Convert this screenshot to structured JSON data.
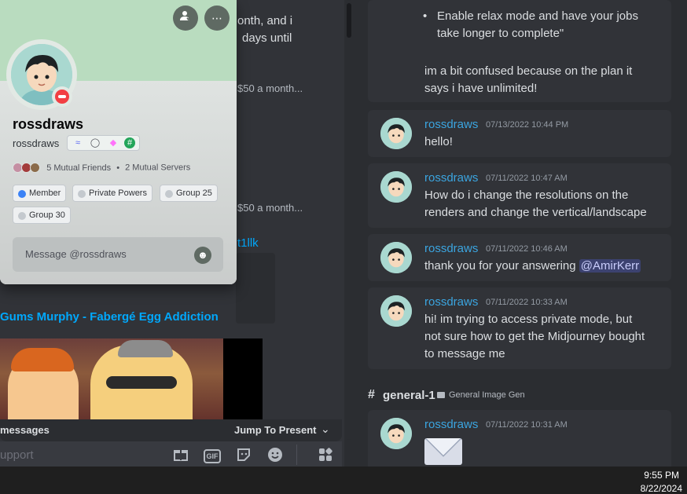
{
  "left_pane": {
    "fragments": [
      {
        "text": "onth, and i"
      },
      {
        "text": "days until"
      },
      {
        "text": "$50 a month..."
      },
      {
        "text": "$50 a month..."
      }
    ],
    "link_tail": "t1llk",
    "video_title": "Gums Murphy - Fabergé Egg Addiction",
    "new_messages_text": "messages",
    "jump_label": "Jump To Present",
    "composer_placeholder": "upport",
    "composer_icons": [
      "gift-icon",
      "gif-icon",
      "sticker-icon",
      "emoji-icon",
      "apps-icon"
    ],
    "gif_label": "GIF"
  },
  "profile": {
    "display_name": "rossdraws",
    "username": "rossdraws",
    "status": "do-not-disturb",
    "mutual_friends": "5 Mutual Friends",
    "mutual_servers": "2 Mutual Servers",
    "roles": [
      {
        "name": "Member",
        "color": "#3b82f6"
      },
      {
        "name": "Private Powers",
        "color": "#c4c9ce"
      },
      {
        "name": "Group 25",
        "color": "#c4c9ce"
      },
      {
        "name": "Group 30",
        "color": "#c4c9ce"
      }
    ],
    "message_placeholder": "Message @rossdraws",
    "badges": [
      "hypesquad-icon",
      "nitro-icon",
      "boost-icon",
      "hashtag-icon"
    ],
    "banner_color": "#b9dcbf"
  },
  "right_pane": {
    "top_card": {
      "bullet_lines": [
        "Enable relax mode and have your jobs",
        "take longer to complete\""
      ],
      "text_lines": [
        "im a bit confused because on the plan it",
        "says i have unlimited!"
      ]
    },
    "messages": [
      {
        "author": "rossdraws",
        "timestamp": "07/13/2022 10:44 PM",
        "lines": [
          "hello!"
        ]
      },
      {
        "author": "rossdraws",
        "timestamp": "07/11/2022 10:47 AM",
        "lines": [
          "How do i change the resolutions on the",
          "renders and change the vertical/landscape"
        ]
      },
      {
        "author": "rossdraws",
        "timestamp": "07/11/2022 10:46 AM",
        "lines": [
          "thank you for your answering "
        ],
        "mention": "@AmirKerr"
      },
      {
        "author": "rossdraws",
        "timestamp": "07/11/2022 10:33 AM",
        "lines": [
          "hi! im trying to access private mode, but",
          "not sure how to get the Midjourney bought",
          "to message me"
        ]
      },
      {
        "author": "rossdraws",
        "timestamp": "07/11/2022 10:31 AM",
        "lines": []
      }
    ],
    "channel": {
      "name": "general-1",
      "category": "General Image Gen"
    }
  },
  "taskbar": {
    "time": "9:55 PM",
    "date": "8/22/2024"
  },
  "colors": {
    "author": "#3ba5e0",
    "link": "#00a8fc",
    "mention_bg": "#3c4270",
    "dnd": "#f23f43"
  }
}
